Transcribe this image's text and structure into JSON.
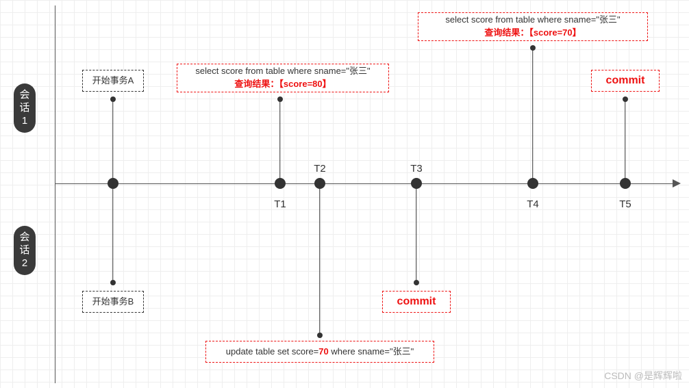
{
  "sessions": {
    "s1": "会话1",
    "s2": "会话2"
  },
  "timeline": {
    "t1": "T1",
    "t2": "T2",
    "t3": "T3",
    "t4": "T4",
    "t5": "T5"
  },
  "events": {
    "startA": "开始事务A",
    "startB": "开始事务B",
    "queryT1_sql": "select score from table where sname=\"张三\"",
    "queryT1_res": "查询结果：【score=80】",
    "updateT2_pre": "update table set score=",
    "updateT2_val": "70",
    "updateT2_post": " where sname=\"张三\"",
    "commitT3": "commit",
    "queryT4_sql": "select score from table where sname=\"张三\"",
    "queryT4_res": "查询结果：【score=70】",
    "commitT5": "commit"
  },
  "watermark": "CSDN @是辉辉啦",
  "chart_data": {
    "type": "timeline",
    "title": "",
    "sessions": [
      "会话1",
      "会话2"
    ],
    "time_points": [
      "T1",
      "T2",
      "T3",
      "T4",
      "T5"
    ],
    "events": [
      {
        "time": "before T1",
        "session": "会话1",
        "action": "开始事务A"
      },
      {
        "time": "before T1",
        "session": "会话2",
        "action": "开始事务B"
      },
      {
        "time": "T1",
        "session": "会话1",
        "action": "select score from table where sname=\"张三\"",
        "result": "score=80"
      },
      {
        "time": "T2",
        "session": "会话2",
        "action": "update table set score=70 where sname=\"张三\""
      },
      {
        "time": "T3",
        "session": "会话2",
        "action": "commit"
      },
      {
        "time": "T4",
        "session": "会话1",
        "action": "select score from table where sname=\"张三\"",
        "result": "score=70"
      },
      {
        "time": "T5",
        "session": "会话1",
        "action": "commit"
      }
    ]
  }
}
